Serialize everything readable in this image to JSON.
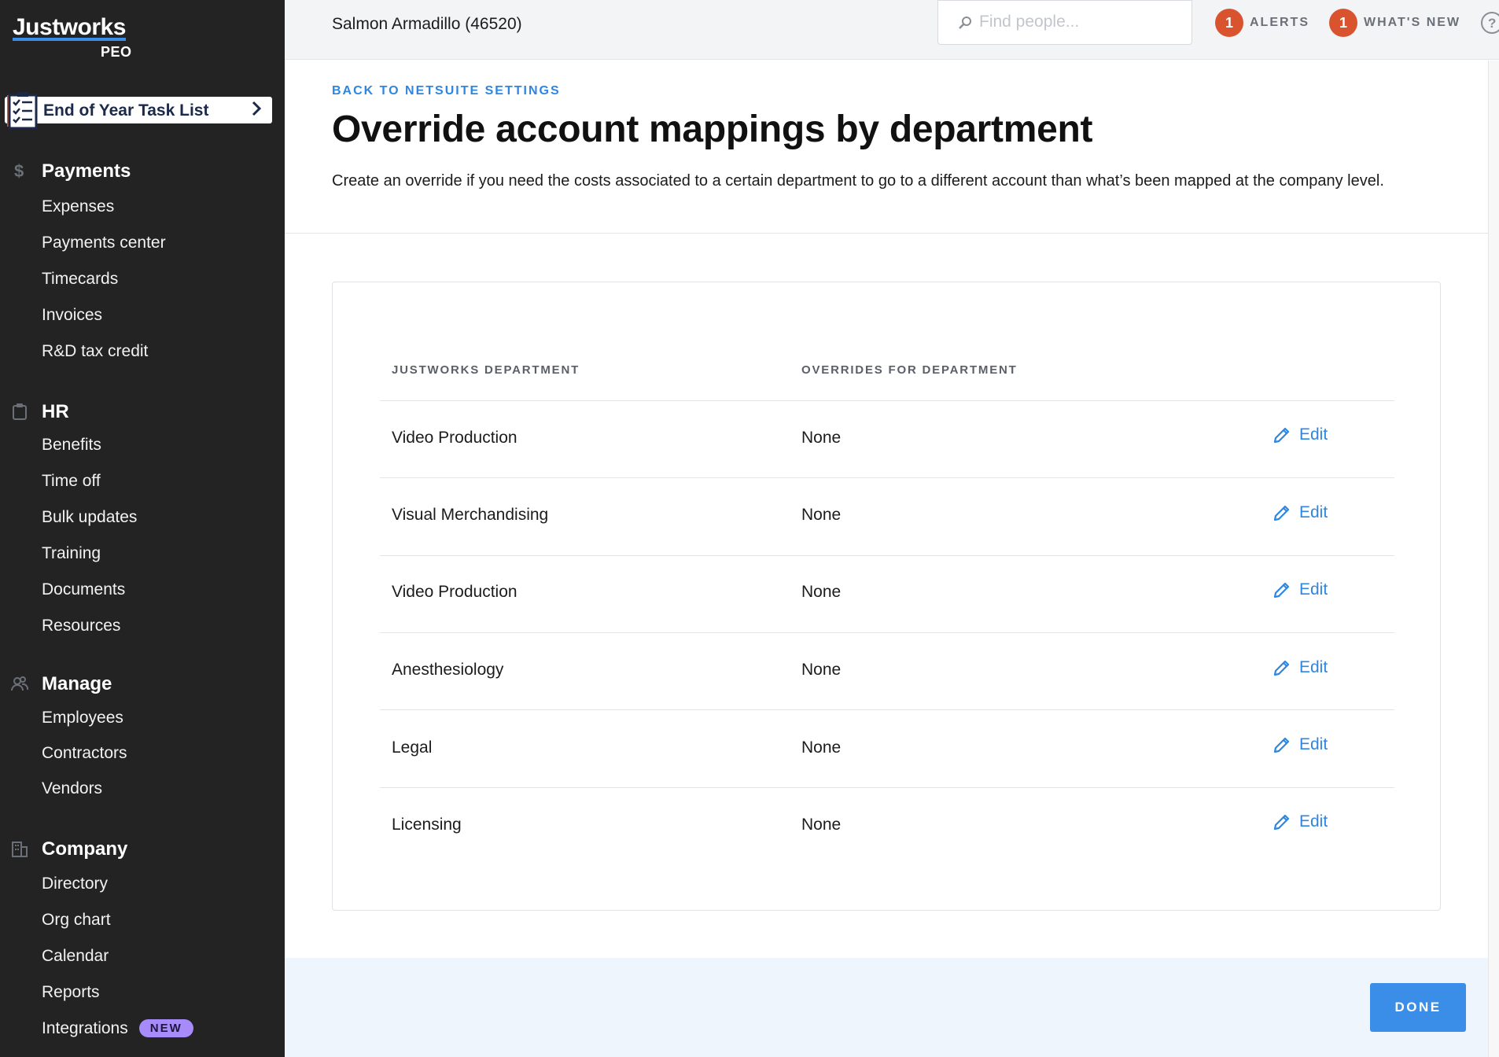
{
  "brand": {
    "name": "Justworks",
    "product": "PEO",
    "accent": "#3b8ee8"
  },
  "task_list": {
    "label": "End of Year Task List"
  },
  "sidebar": {
    "payments": {
      "title": "Payments",
      "items": [
        "Expenses",
        "Payments center",
        "Timecards",
        "Invoices",
        "R&D tax credit"
      ]
    },
    "hr": {
      "title": "HR",
      "items": [
        "Benefits",
        "Time off",
        "Bulk updates",
        "Training",
        "Documents",
        "Resources"
      ]
    },
    "manage": {
      "title": "Manage",
      "items": [
        "Employees",
        "Contractors",
        "Vendors"
      ]
    },
    "company": {
      "title": "Company",
      "items": [
        "Directory",
        "Org chart",
        "Calendar",
        "Reports",
        "Integrations"
      ],
      "badge": "NEW"
    }
  },
  "header": {
    "company": "Salmon Armadillo (46520)",
    "search_placeholder": "Find people...",
    "alerts": {
      "count": "1",
      "label": "ALERTS"
    },
    "whats_new": {
      "count": "1",
      "label": "WHAT'S NEW"
    }
  },
  "page": {
    "back_label": "BACK TO NETSUITE SETTINGS",
    "title": "Override account mappings by department",
    "description": "Create an override if you need the costs associated to a certain department to go to a different account than what’s been mapped at the company level."
  },
  "table": {
    "headers": [
      "JUSTWORKS DEPARTMENT",
      "OVERRIDES FOR DEPARTMENT"
    ],
    "edit_label": "Edit",
    "rows": [
      {
        "department": "Video Production",
        "override": "None"
      },
      {
        "department": "Visual Merchandising",
        "override": "None"
      },
      {
        "department": "Video Production",
        "override": "None"
      },
      {
        "department": "Anesthesiology",
        "override": "None"
      },
      {
        "department": "Legal",
        "override": "None"
      },
      {
        "department": "Licensing",
        "override": "None"
      }
    ]
  },
  "footer": {
    "done_label": "DONE"
  }
}
